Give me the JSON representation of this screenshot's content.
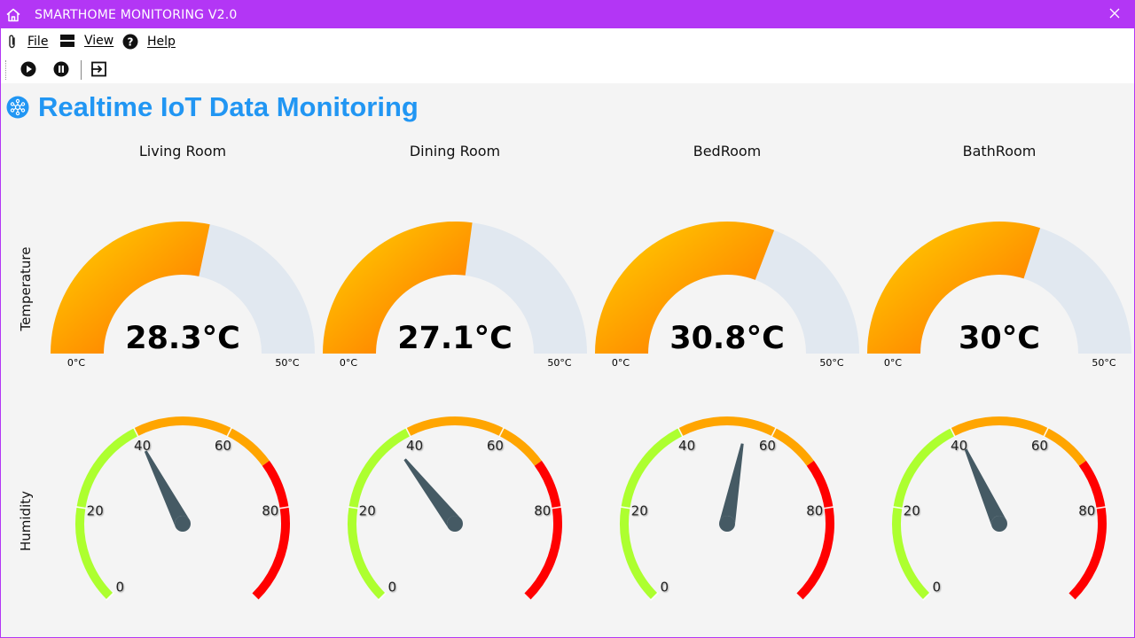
{
  "window": {
    "title": "SMARTHOME MONITORING V2.0"
  },
  "menu": {
    "file": "File",
    "view": "View",
    "help": "Help"
  },
  "heading": "Realtime IoT Data Monitoring",
  "rows": {
    "temperature": "Temperature",
    "humidity": "Humidity"
  },
  "temperature_scale": {
    "min_label": "0°C",
    "max_label": "50°C",
    "min": 0,
    "max": 50
  },
  "humidity_scale": {
    "ticks": [
      "0",
      "20",
      "40",
      "60",
      "80"
    ]
  },
  "rooms": [
    {
      "name": "Living Room",
      "temperature": 28.3,
      "temperature_label": "28.3°C",
      "humidity": 40
    },
    {
      "name": "Dining Room",
      "temperature": 27.1,
      "temperature_label": "27.1°C",
      "humidity": 36
    },
    {
      "name": "BedRoom",
      "temperature": 30.8,
      "temperature_label": "30.8°C",
      "humidity": 54
    },
    {
      "name": "BathRoom",
      "temperature": 30,
      "temperature_label": "30°C",
      "humidity": 41
    }
  ],
  "colors": {
    "titlebar": "#b336f5",
    "heading": "#2196f3",
    "gauge_track": "#e1e8f0",
    "gauge_fill_start": "#ffd400",
    "gauge_fill_end": "#ff6a00",
    "humidity_low": "#adff2f",
    "humidity_mid": "#ffa500",
    "humidity_high": "#ff0000",
    "needle": "#455a64"
  }
}
